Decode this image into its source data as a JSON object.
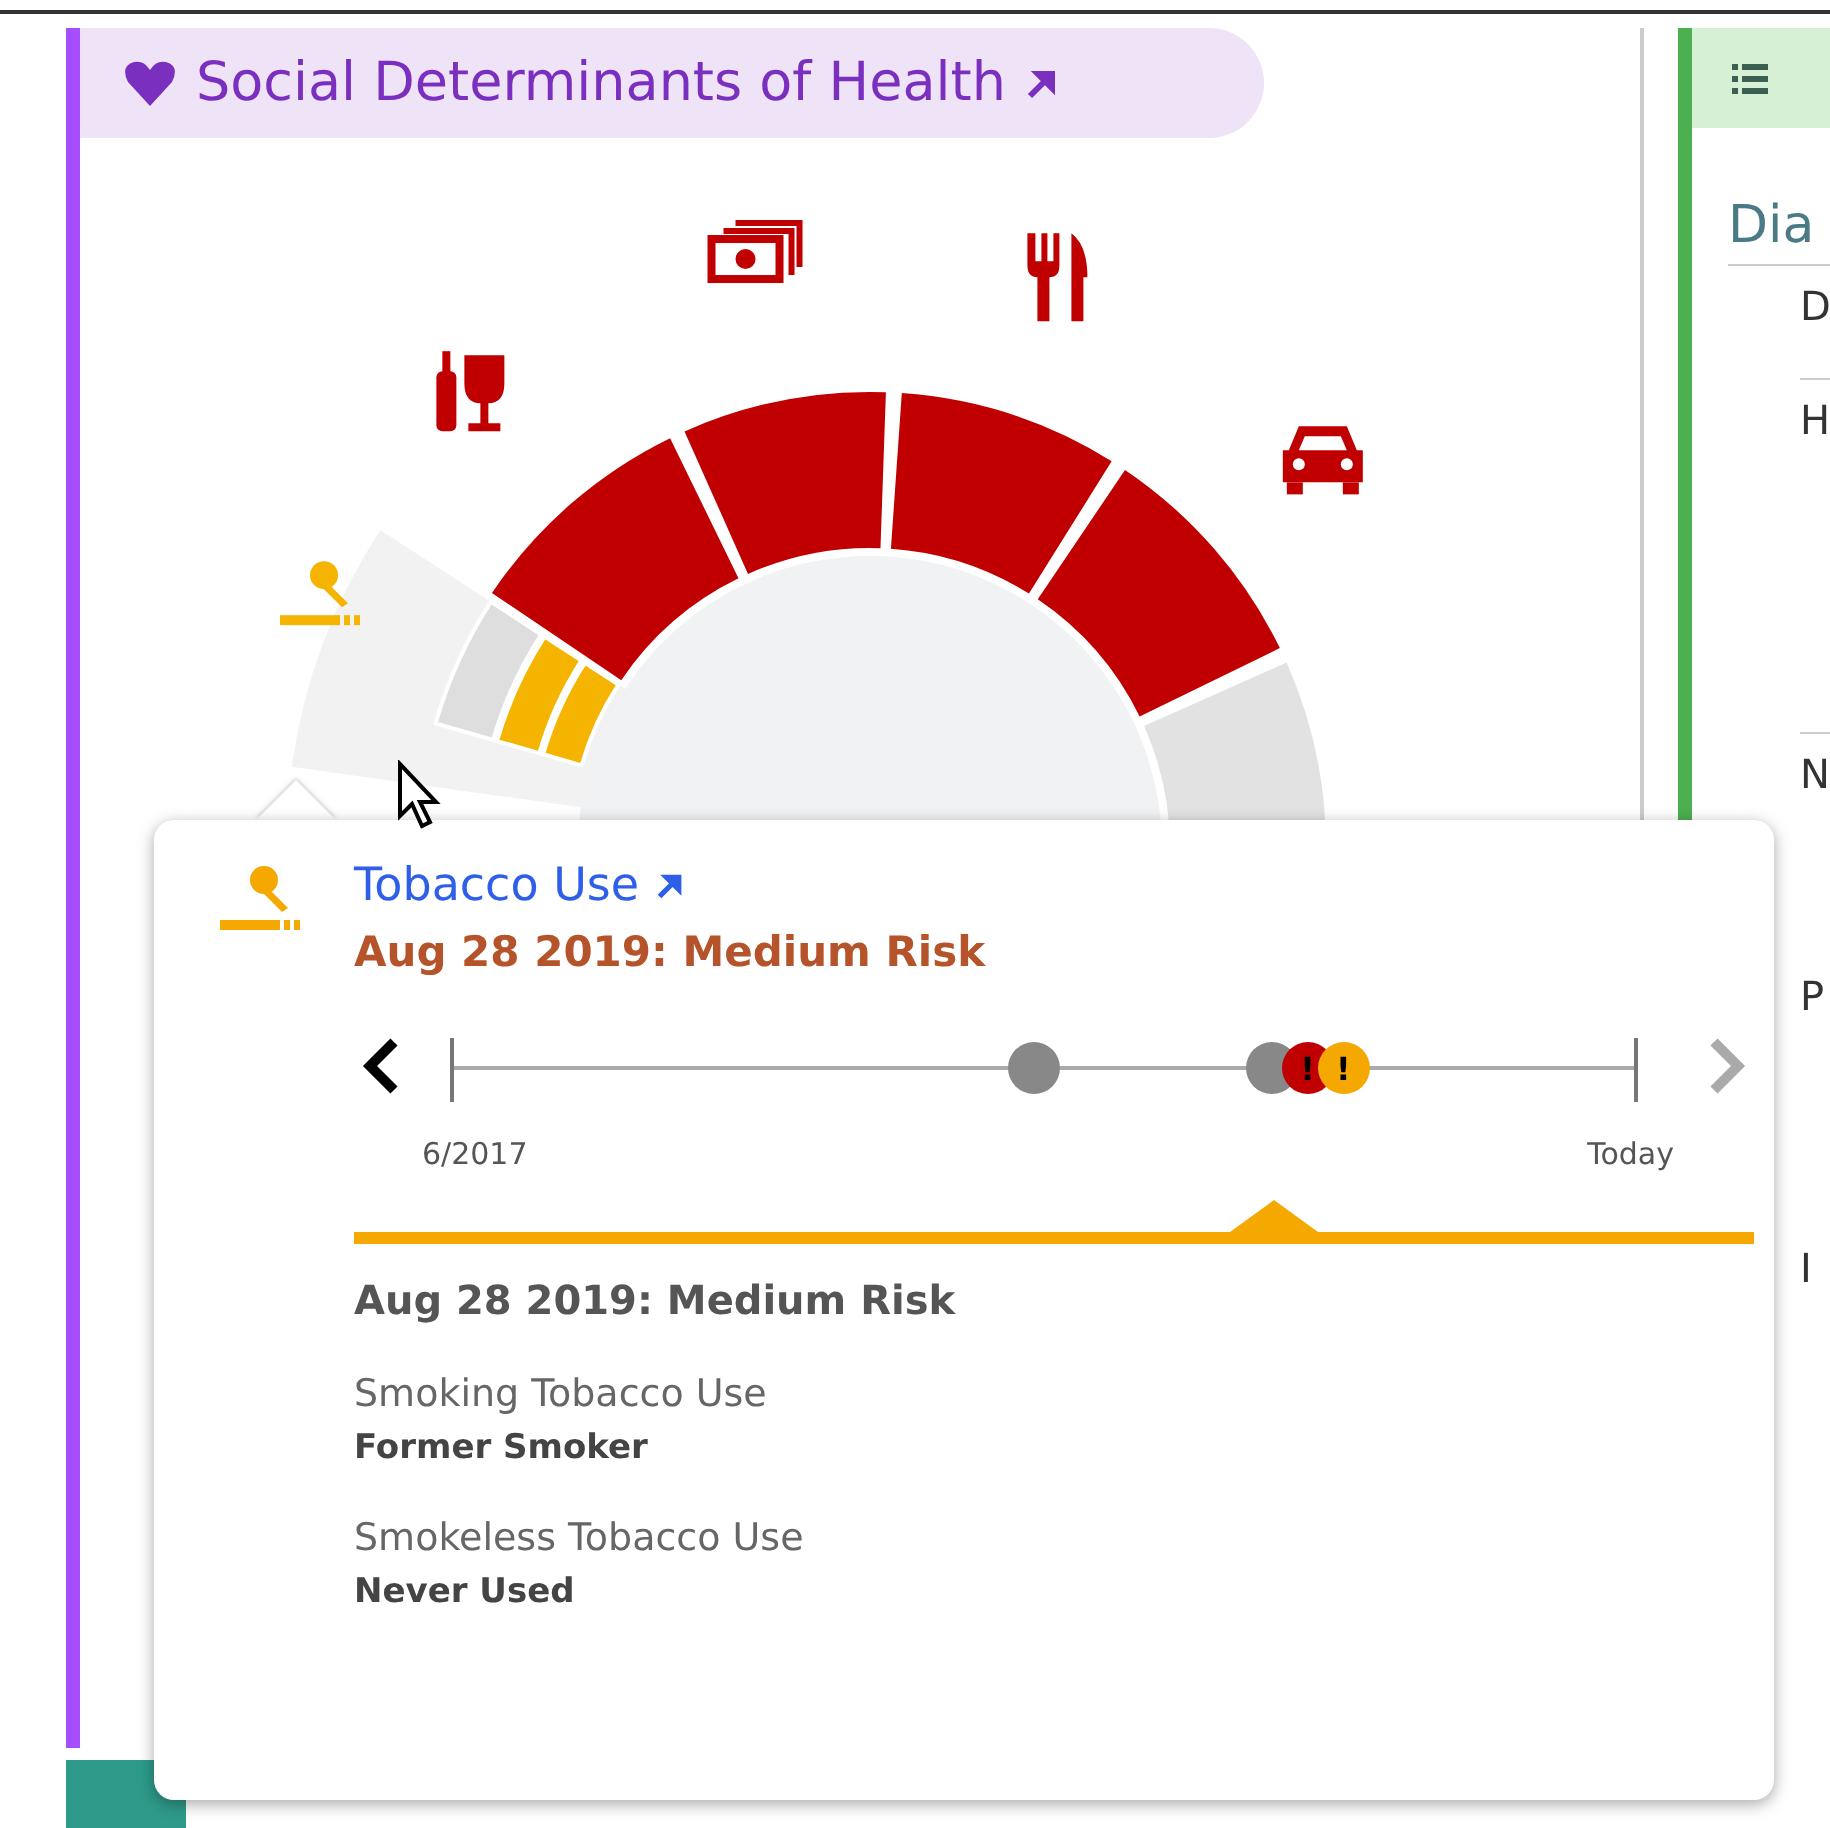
{
  "sdoh_panel": {
    "title": "Social Determinants of Health",
    "chart": {
      "segments": [
        {
          "kind": "rings",
          "color": "#f5b400"
        },
        {
          "kind": "solid",
          "color": "#c00000"
        },
        {
          "kind": "solid",
          "color": "#c00000"
        },
        {
          "kind": "solid",
          "color": "#c00000"
        },
        {
          "kind": "solid",
          "color": "#c00000"
        },
        {
          "kind": "empty",
          "color": "#e2e2e2"
        }
      ]
    }
  },
  "side_panel": {
    "heading": "Dia",
    "rows": [
      "D",
      "H",
      "N",
      "P",
      "I"
    ]
  },
  "popup": {
    "title": "Tobacco Use",
    "subtitle": "Aug 28 2019: Medium Risk",
    "timeline": {
      "start_label": "6/2017",
      "end_label": "Today",
      "prev_disabled": false,
      "next_disabled": true,
      "events": [
        {
          "kind": "past"
        },
        {
          "kind": "past"
        },
        {
          "kind": "high",
          "mark": "!"
        },
        {
          "kind": "medium",
          "mark": "!"
        }
      ]
    },
    "detail_heading": "Aug 28 2019: Medium Risk",
    "fields": [
      {
        "label": "Smoking Tobacco Use",
        "value": "Former Smoker"
      },
      {
        "label": "Smokeless Tobacco Use",
        "value": "Never Used"
      }
    ]
  }
}
